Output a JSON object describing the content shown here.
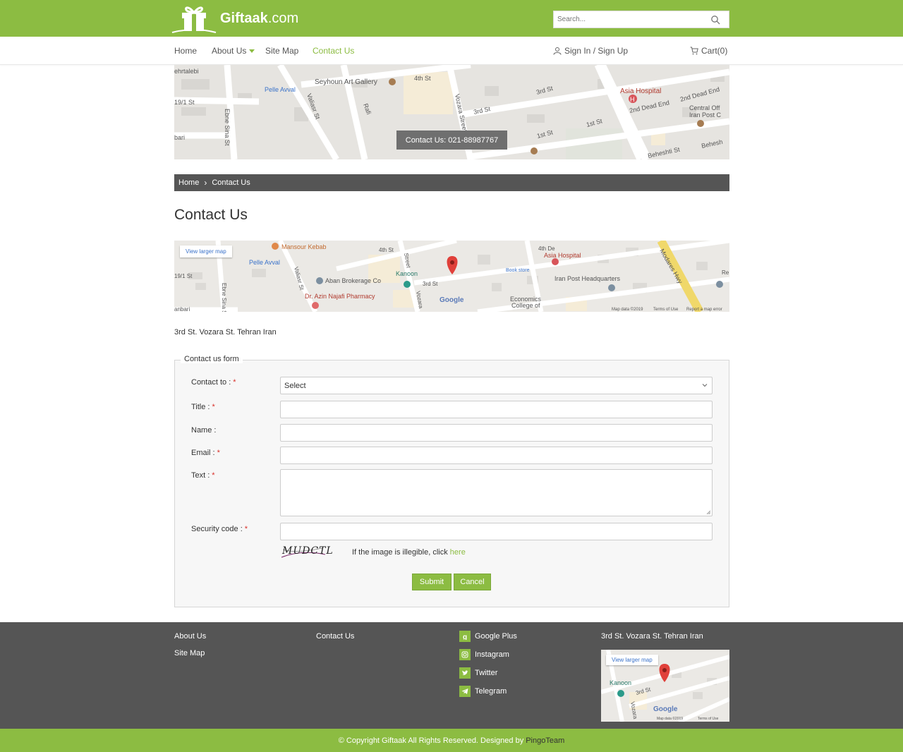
{
  "header": {
    "logo_text": "Giftaak",
    "logo_domain": ".com",
    "search_placeholder": "Search..."
  },
  "nav": {
    "items": [
      {
        "label": "Home"
      },
      {
        "label": "About Us"
      },
      {
        "label": "Site Map"
      },
      {
        "label": "Contact Us"
      }
    ],
    "sign_in": "Sign In / Sign Up",
    "cart": "Cart(0)"
  },
  "banner": {
    "badge": "Contact Us: 021-88987767",
    "map_labels": [
      "Seyhoun Art Gallery",
      "Pelle Avval",
      "Asia Hospital",
      "2nd Dead End",
      "Central Off",
      "Iran Post C",
      "Valiasr St",
      "Vozara Street",
      "Ebne Sina St",
      "4th St",
      "3rd St",
      "1st St",
      "19/1 St",
      "Rafi",
      "Beheshti St",
      "ehrtalebi",
      "bari"
    ]
  },
  "breadcrumb": {
    "home": "Home",
    "current": "Contact Us"
  },
  "page_title": "Contact Us",
  "map_embed": {
    "view_larger": "View larger map",
    "labels": [
      "Mansour Kebab",
      "Pelle Avval",
      "Aban Brokerage Co",
      "Dr. Azin Najafi Pharmacy",
      "Kanoon",
      "Asia Hospital",
      "Iran Post Headquarters",
      "Economics College of",
      "Modares Hwy",
      "Book store",
      "Google",
      "4th St",
      "3rd St",
      "19/1 St",
      "Vozara",
      "Valiasr St",
      "Ebne Sina St",
      "Street"
    ],
    "footer_text": [
      "Map data ©2019",
      "Terms of Use",
      "Report a map error"
    ]
  },
  "address": "3rd St. Vozara St. Tehran Iran",
  "form": {
    "legend": "Contact us form",
    "fields": {
      "contact_to": {
        "label": "Contact to :",
        "value": "Select"
      },
      "title": {
        "label": "Title :"
      },
      "name": {
        "label": "Name :"
      },
      "email": {
        "label": "Email :"
      },
      "text": {
        "label": "Text :"
      },
      "security": {
        "label": "Security code :"
      }
    },
    "captcha_text": "MUDCTL",
    "captcha_hint": "If the image is illegible, click",
    "captcha_link": "here",
    "submit": "Submit",
    "cancel": "Cancel"
  },
  "footer": {
    "col1": [
      "About Us",
      "Site Map"
    ],
    "col2": [
      "Contact Us"
    ],
    "social": [
      {
        "label": "Google Plus",
        "icon": "google-plus-icon"
      },
      {
        "label": "Instagram",
        "icon": "instagram-icon"
      },
      {
        "label": "Twitter",
        "icon": "twitter-icon"
      },
      {
        "label": "Telegram",
        "icon": "telegram-icon"
      }
    ],
    "address": "3rd St. Vozara St. Tehran Iran",
    "map_view_larger": "View larger map",
    "map_labels": [
      "Kanoon",
      "3rd St",
      "Vozara",
      "Google",
      "Map data ©2019",
      "Terms of Use"
    ],
    "copyright": "© Copyright Giftaak All Rights Reserved. Designed by",
    "designer": "PingoTeam"
  },
  "colors": {
    "brand_green": "#8cbc42",
    "dark_gray": "#555555",
    "required_red": "#d9302a"
  }
}
